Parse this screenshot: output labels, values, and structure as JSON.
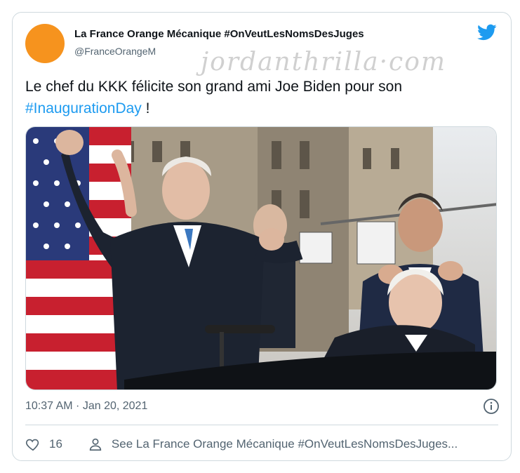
{
  "tweet": {
    "author_name": "La France Orange Mécanique #OnVeutLesNomsDesJuges",
    "author_handle": "@FranceOrangeM",
    "text_main": "Le chef du KKK félicite son grand ami Joe Biden pour son",
    "hashtag": "#InaugurationDay",
    "text_end": " !",
    "timestamp": "10:37 AM · Jan 20, 2021",
    "like_count": "16",
    "see_more": "See La France Orange Mécanique #OnVeutLesNomsDesJuges..."
  },
  "watermark": "jordanthrilla·com",
  "icons": {
    "bird": "twitter-bird-icon",
    "info": "info-icon",
    "like": "heart-icon",
    "profile": "person-icon"
  },
  "colors": {
    "accent": "#1d9bf0",
    "avatar": "#f6931e",
    "text_secondary": "#536471"
  }
}
